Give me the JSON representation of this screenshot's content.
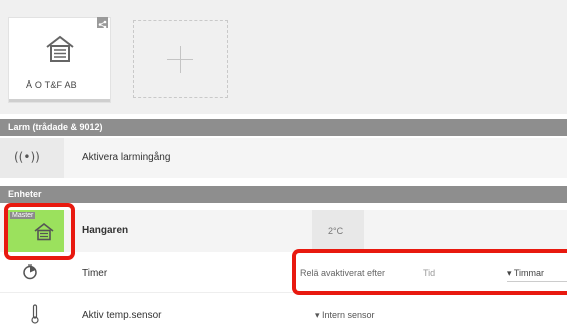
{
  "devices": {
    "card_name": "Å O T&F AB"
  },
  "sections": {
    "alarm": "Larm (trådade & 9012)",
    "units": "Enheter"
  },
  "alarm": {
    "label": "Aktivera larmingång",
    "icon": "alarm-broadcast-icon"
  },
  "unit": {
    "master_tag": "Master",
    "name": "Hangaren",
    "temperature": "2°C",
    "icon": "house-icon",
    "color": "#9be15d"
  },
  "timer": {
    "label": "Timer",
    "relay_label": "Relä avaktiverat efter",
    "time_placeholder": "Tid",
    "unit_select": "▾ Timmar"
  },
  "sensor": {
    "label": "Aktiv temp.sensor",
    "select": "▾ Intern sensor"
  },
  "colors": {
    "highlight": "#e8190f",
    "section_bg": "#8e8e8e"
  }
}
